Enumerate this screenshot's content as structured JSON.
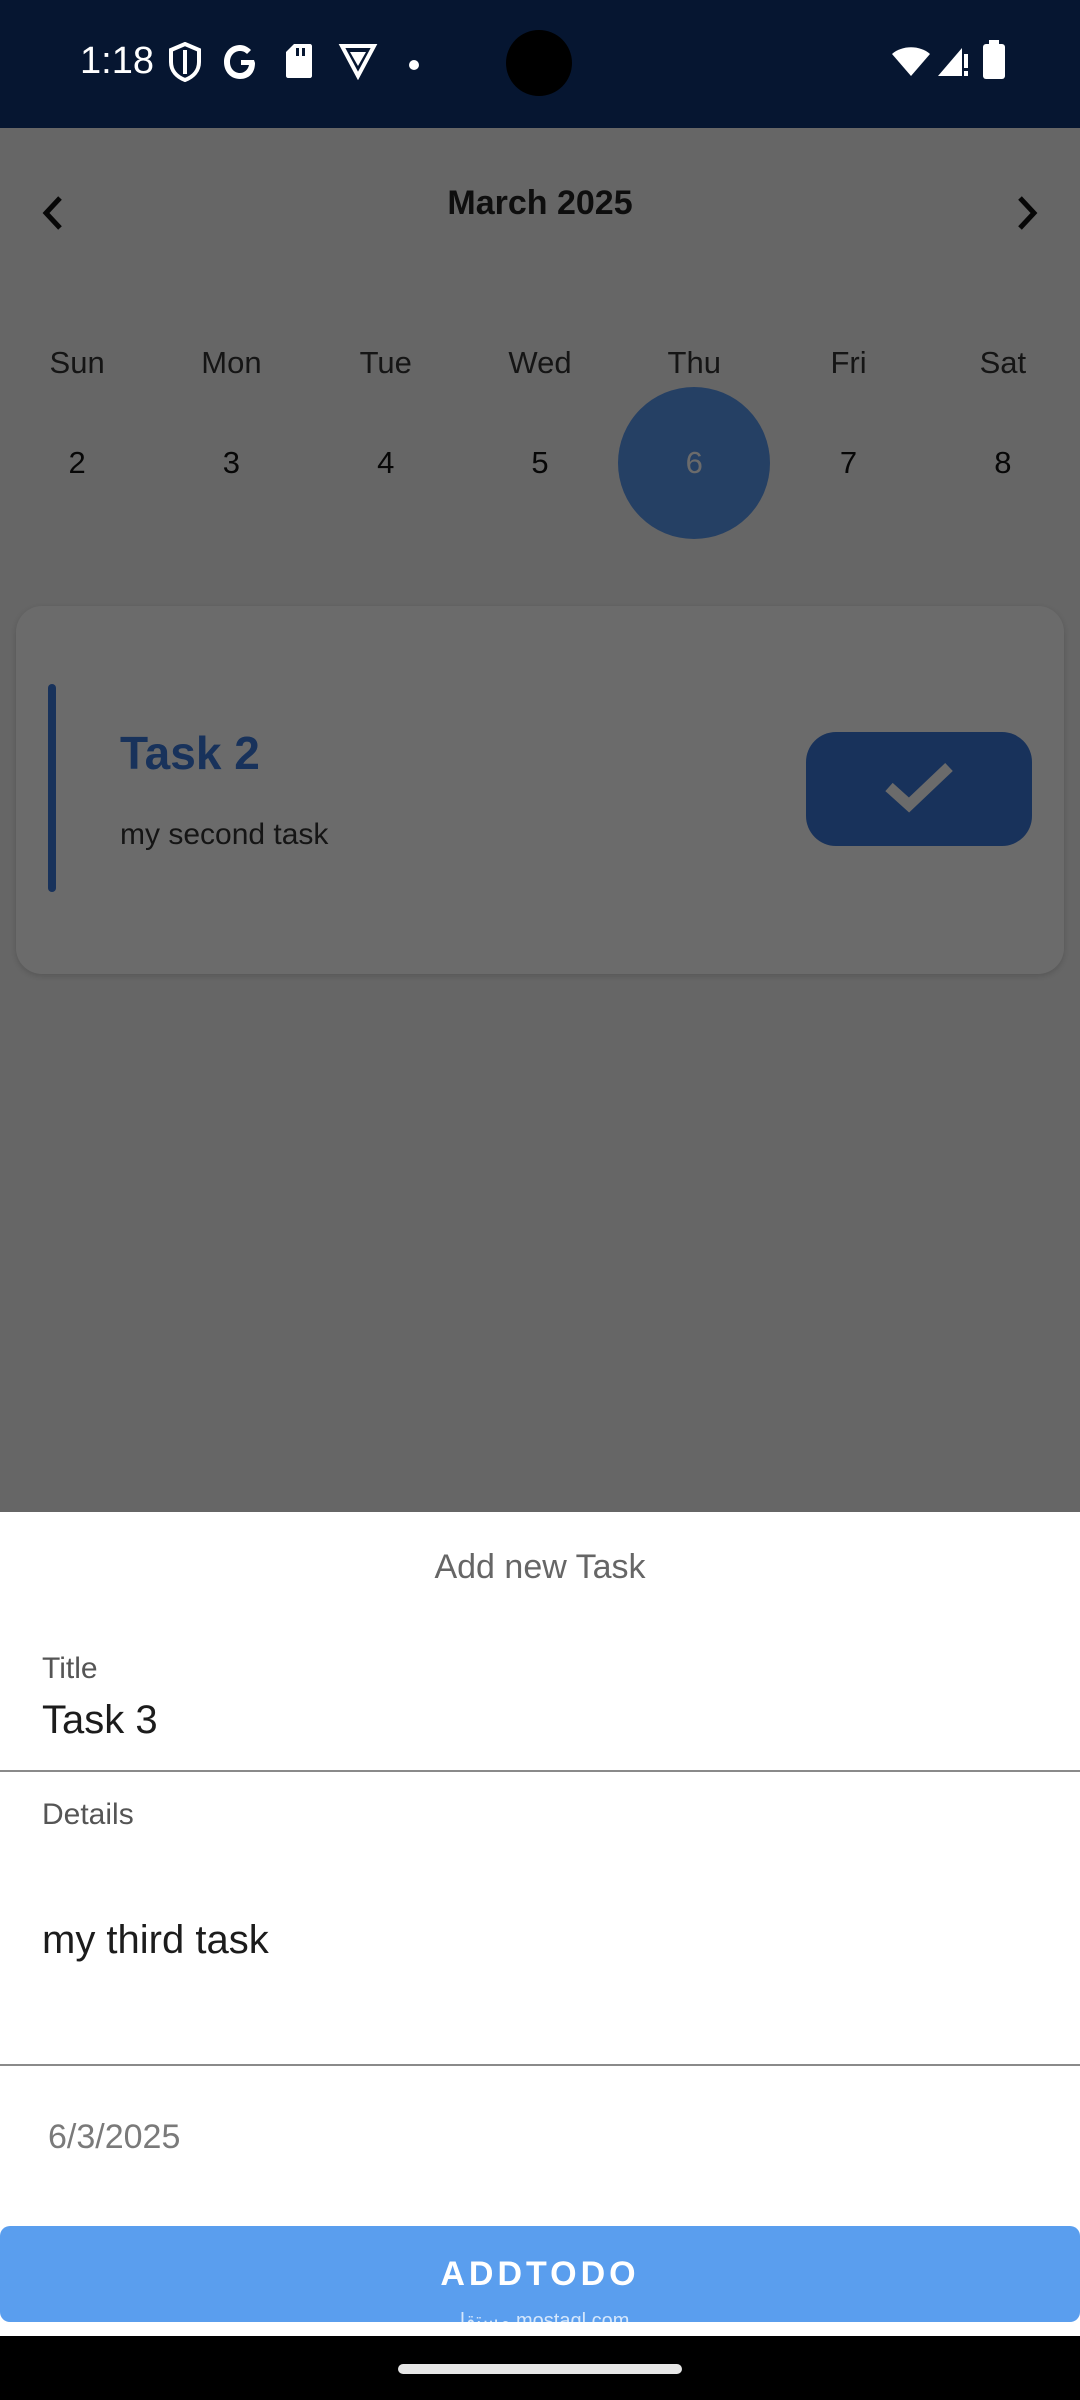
{
  "status_bar": {
    "time": "1:18",
    "left_icons": [
      "shield-icon",
      "google-icon",
      "sd-card-icon",
      "vpn-icon",
      "dot-icon"
    ],
    "right_icons": [
      "wifi-icon",
      "signal-icon",
      "battery-icon"
    ]
  },
  "calendar": {
    "month_title": "March 2025",
    "weekdays": [
      "Sun",
      "Mon",
      "Tue",
      "Wed",
      "Thu",
      "Fri",
      "Sat"
    ],
    "days": [
      "2",
      "3",
      "4",
      "5",
      "6",
      "7",
      "8"
    ],
    "selected_day": "6"
  },
  "task_list": [
    {
      "title": "Task 2",
      "details": "my second task"
    }
  ],
  "sheet": {
    "title": "Add new Task",
    "title_field": {
      "label": "Title",
      "value": "Task 3"
    },
    "details_field": {
      "label": "Details",
      "value": "my third task"
    },
    "date_value": "6/3/2025",
    "add_button_label": "ADDTODO"
  },
  "watermark": "مستقل mostaql.com",
  "colors": {
    "accent": "#3b78d8",
    "selected_day": "#5a98ee",
    "button": "#5a9eee",
    "status_bar": "#061631"
  }
}
